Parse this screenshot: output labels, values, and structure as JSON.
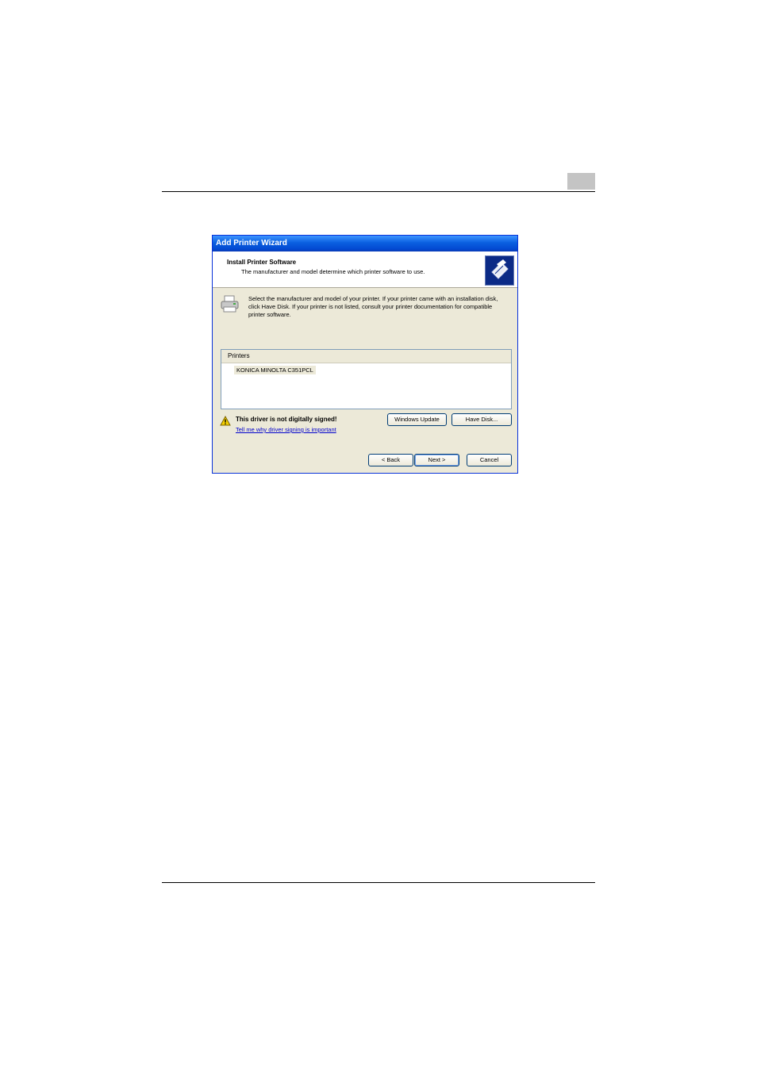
{
  "window": {
    "title": "Add Printer Wizard"
  },
  "header": {
    "title": "Install Printer Software",
    "subtitle": "The manufacturer and model determine which printer software to use.",
    "icon": "wizard-printer-icon"
  },
  "description": "Select the manufacturer and model of your printer. If your printer came with an installation disk, click Have Disk. If your printer is not listed, consult your printer documentation for compatible printer software.",
  "printer_list": {
    "header": "Printers",
    "items": [
      "KONICA MINOLTA C351PCL"
    ],
    "selected": "KONICA MINOLTA C351PCL"
  },
  "warning": {
    "text": "This driver is not digitally signed!",
    "link": "Tell me why driver signing is important",
    "icon": "warning-icon"
  },
  "buttons": {
    "windows_update": "Windows Update",
    "have_disk": "Have Disk...",
    "back": "< Back",
    "next": "Next >",
    "cancel": "Cancel"
  },
  "colors": {
    "titlebar": "#0a5fe0",
    "dialog_bg": "#ece9d8",
    "link": "#0000cc"
  }
}
